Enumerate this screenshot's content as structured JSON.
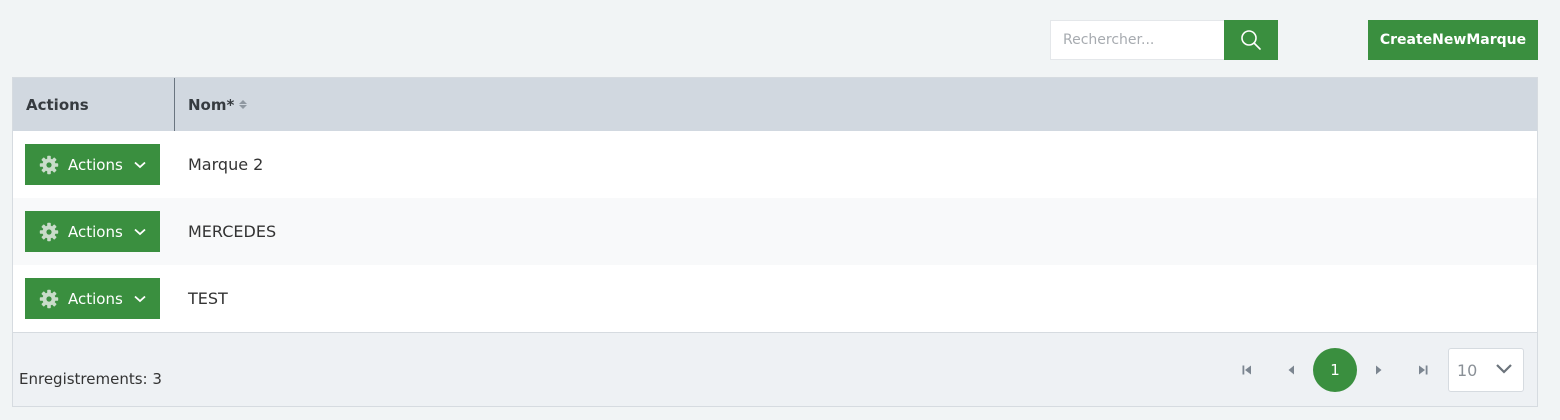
{
  "toolbar": {
    "search_placeholder": "Rechercher...",
    "search_icon": "search-icon",
    "create_label": "CreateNewMarque"
  },
  "table": {
    "columns": [
      "Actions",
      "Nom*"
    ],
    "rows": [
      {
        "action_label": "Actions",
        "name": "Marque 2"
      },
      {
        "action_label": "Actions",
        "name": "MERCEDES"
      },
      {
        "action_label": "Actions",
        "name": "TEST"
      }
    ]
  },
  "footer": {
    "record_count": "Enregistrements: 3",
    "current_page": "1",
    "page_size": "10"
  },
  "colors": {
    "primary": "#3a8f3f",
    "header_bg": "#d1d8e0",
    "page_bg": "#f1f4f5"
  }
}
